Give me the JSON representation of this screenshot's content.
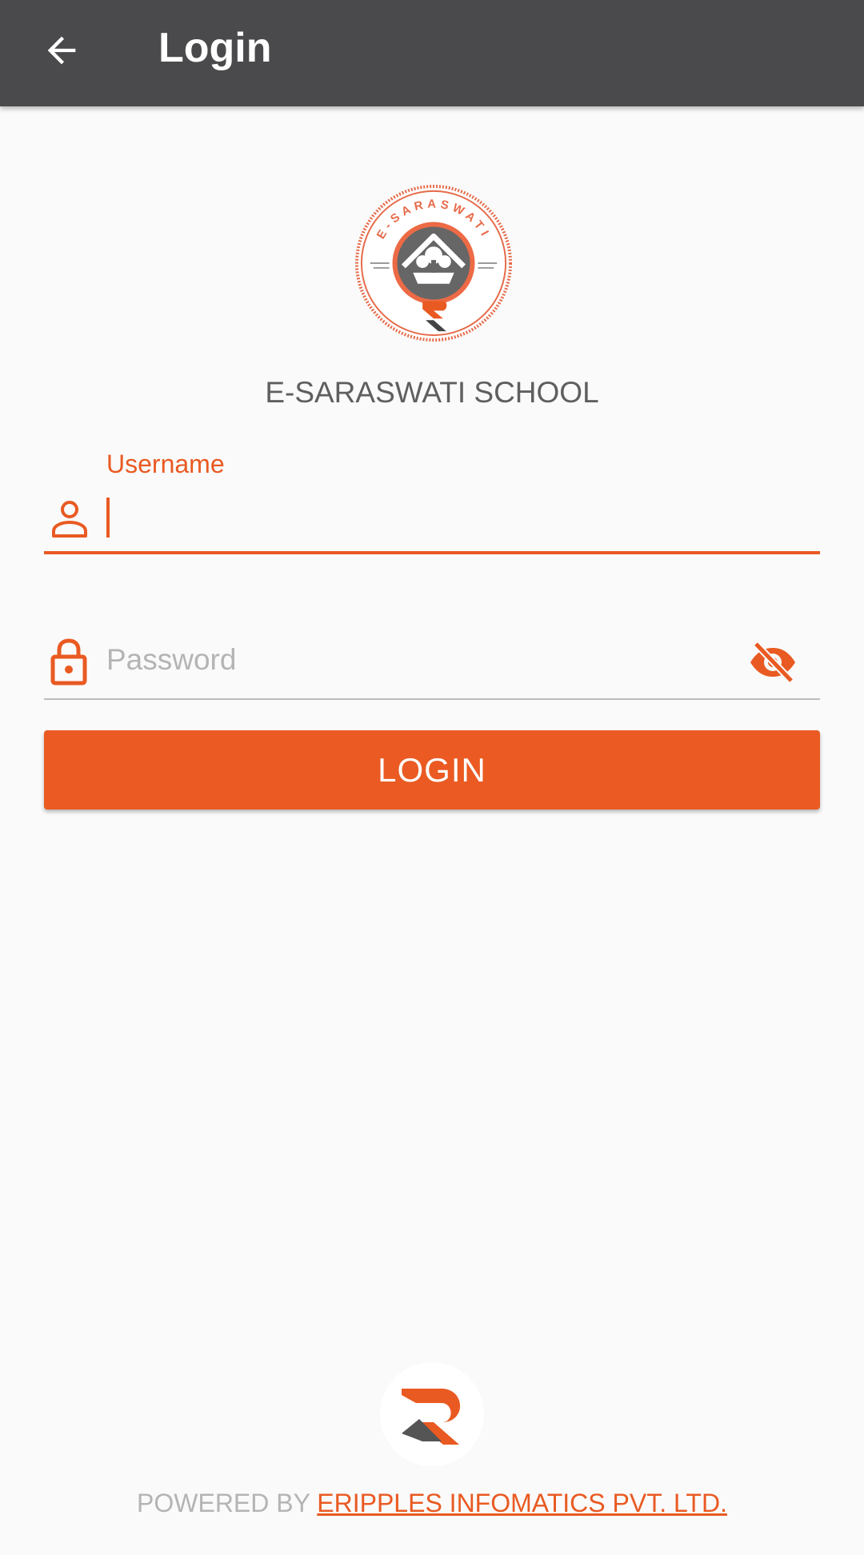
{
  "header": {
    "title": "Login",
    "back_icon": "arrow-left-icon",
    "background": "#4a4a4c"
  },
  "logo": {
    "seal_text": "E-SARASWATI",
    "school_name": "E-SARASWATI SCHOOL"
  },
  "form": {
    "username_label": "Username",
    "username_value": "",
    "username_icon": "person-icon",
    "password_placeholder": "Password",
    "password_value": "",
    "password_icon": "lock-icon",
    "visibility_icon": "eye-off-icon",
    "login_label": "LOGIN"
  },
  "footer": {
    "prefix": "POWERED BY ",
    "company": "ERIPPLES INFOMATICS PVT. LTD."
  },
  "colors": {
    "accent": "#ea5a22",
    "header": "#4a4a4c",
    "background": "#fafafa",
    "muted_text": "#b4b4b4"
  }
}
